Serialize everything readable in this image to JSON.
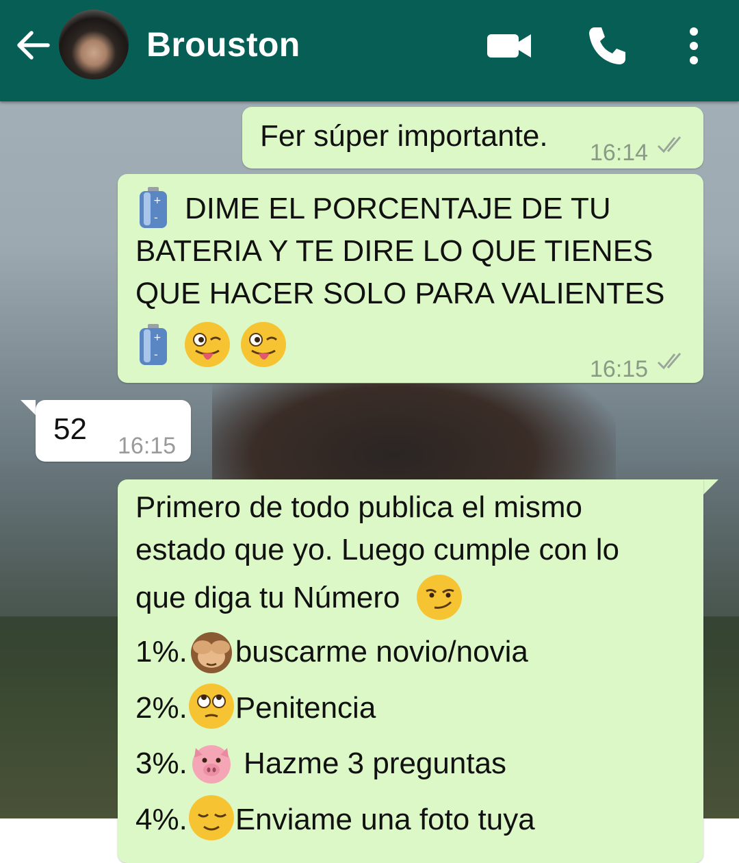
{
  "header": {
    "contact_name": "Brouston",
    "back_icon": "arrow-left-icon",
    "video_icon": "video-camera-icon",
    "call_icon": "phone-icon",
    "menu_icon": "more-vertical-icon",
    "color": "#075e54"
  },
  "messages": [
    {
      "direction": "out",
      "text": "Fer súper importante.",
      "time": "16:14",
      "status": "read"
    },
    {
      "direction": "out",
      "lines": [
        "DIME EL PORCENTAJE DE TU",
        "BATERIA Y TE DIRE LO QUE TIENES",
        "QUE HACER SOLO PARA VALIENTES"
      ],
      "emojis": [
        "battery",
        "battery",
        "winking-face-tongue",
        "winking-face-tongue"
      ],
      "time": "16:15",
      "status": "read"
    },
    {
      "direction": "in",
      "text": "52",
      "time": "16:15"
    },
    {
      "direction": "out",
      "lines": [
        "Primero de todo publica el mismo",
        "estado que yo. Luego cumple con lo",
        "que diga tu Número"
      ],
      "list": [
        {
          "number": "1%.",
          "text": "buscarme novio/novia",
          "emoji": "see-no-evil-monkey"
        },
        {
          "number": "2%.",
          "text": "Penitencia",
          "emoji": "face-rolling-eyes"
        },
        {
          "number": "3%.",
          "text": " Hazme 3 preguntas",
          "emoji": "pig-face"
        },
        {
          "number": "4%.",
          "text": "Enviame una foto tuya",
          "emoji": "relieved-face"
        }
      ]
    }
  ],
  "colors": {
    "outgoing_bubble": "#dcf8c6",
    "incoming_bubble": "#ffffff",
    "read_ticks": "#9aa69a"
  }
}
